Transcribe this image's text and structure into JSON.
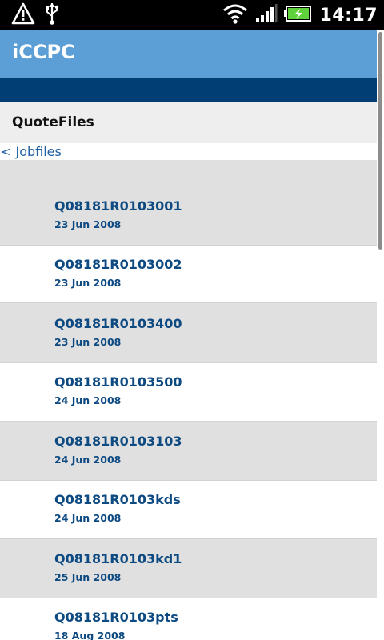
{
  "status_bar": {
    "time": "14:17",
    "icons": [
      "warning-icon",
      "usb-icon",
      "wifi-icon",
      "signal-icon",
      "battery-charging-icon"
    ],
    "colors": {
      "battery": "#5fd13a"
    }
  },
  "app": {
    "title": "iCCPC"
  },
  "section": {
    "title": "QuoteFiles"
  },
  "back_link": {
    "label": "< Jobfiles"
  },
  "files": [
    {
      "name": "Q08181R0103001",
      "date": "23 Jun 2008"
    },
    {
      "name": "Q08181R0103002",
      "date": "23 Jun 2008"
    },
    {
      "name": "Q08181R0103400",
      "date": "23 Jun 2008"
    },
    {
      "name": "Q08181R0103500",
      "date": "24 Jun 2008"
    },
    {
      "name": "Q08181R0103103",
      "date": "24 Jun 2008"
    },
    {
      "name": "Q08181R0103kds",
      "date": "24 Jun 2008"
    },
    {
      "name": "Q08181R0103kd1",
      "date": "25 Jun 2008"
    },
    {
      "name": "Q08181R0103pts",
      "date": "18 Aug 2008"
    }
  ],
  "colors": {
    "title_bar": "#5b9fd6",
    "nav_band": "#003e74",
    "link_text": "#0d4a82"
  }
}
